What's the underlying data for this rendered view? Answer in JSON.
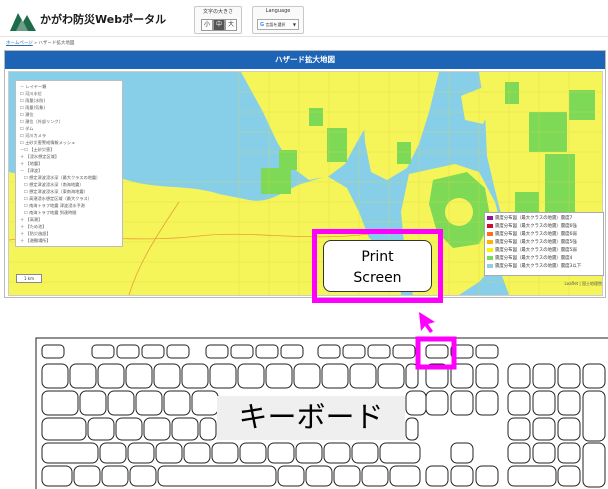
{
  "header": {
    "site_title": "かがわ防災Webポータル",
    "font_size_label": "文字の大きさ",
    "font_size_options": [
      "小",
      "中",
      "大"
    ],
    "font_size_selected": "中",
    "language_label": "Language",
    "language_select": "言語を選択",
    "language_select_icon": "G"
  },
  "breadcrumb": {
    "home": "ホームページ",
    "separator": "»",
    "current": "ハザード拡大地図"
  },
  "panel": {
    "title": "ハザード拡大地図"
  },
  "layers": [
    "－ レイヤー類",
    "☐ 河川水位",
    "☐ 雨量(水防)",
    "☐ 雨量(気象)",
    "☐ 潮位",
    "☐ 潮位（外部リンク）",
    "☐ ダム",
    "☐ 河川カメラ",
    "☐ 土砂災害警戒情報メッシュ",
    "－☐ 【土砂災害】",
    "＋ 【浸水想定区域】",
    "＋ 【地震】",
    "－ 【津波】",
    "☐ 想定津波浸水深（最大クラスの地震）",
    "☐ 想定津波浸水深（南海地震）",
    "☐ 想定津波浸水深（東南海地震）",
    "☐ 高潮浸水想定区域（最大クラス）",
    "☐ 南海トラフ地震 津波浸水予測",
    "☐ 南海トラフ地震 到達時間",
    "＋ 【高潮】",
    "＋ 【ため池】",
    "＋ 【防災施設】",
    "＋ 【避難場所】"
  ],
  "legend": [
    "震度分布図（最大クラスの地震）震度7",
    "震度分布図（最大クラスの地震）震度6強",
    "震度分布図（最大クラスの地震）震度6弱",
    "震度分布図（最大クラスの地震）震度5強",
    "震度分布図（最大クラスの地震）震度5弱",
    "震度分布図（最大クラスの地震）震度4",
    "震度分布図（最大クラスの地震）震度3以下"
  ],
  "legend_colors": [
    "#8b1a9b",
    "#c8102e",
    "#ff6f1a",
    "#ffb300",
    "#f5f500",
    "#7ed957",
    "#9ecae1"
  ],
  "map": {
    "scale": "1 km",
    "attribution": "Leaflet | 国土地理院",
    "zoom": "+ −"
  },
  "callout": {
    "key_line1": "Print",
    "key_line2": "Screen",
    "highlight_color": "#ff00ff"
  },
  "keyboard": {
    "label": "キーボード"
  },
  "icons": {
    "logo": "mountain-logo-icon",
    "pointer": "arrow-pointer-icon"
  },
  "colors": {
    "header_bar": "#1d64b7",
    "sea": "#87cfe8",
    "land": "#f5f55a",
    "hazard": "#7ed957"
  }
}
